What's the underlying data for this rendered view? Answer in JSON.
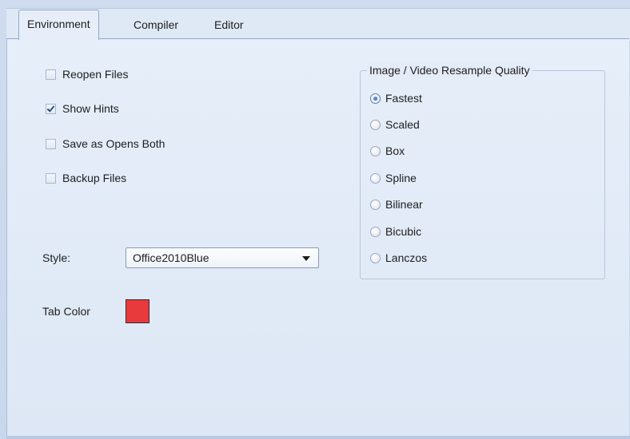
{
  "tabs": [
    {
      "label": "Environment",
      "active": true
    },
    {
      "label": "Compiler",
      "active": false
    },
    {
      "label": "Editor",
      "active": false
    }
  ],
  "options": [
    {
      "label": "Reopen Files",
      "checked": false
    },
    {
      "label": "Show Hints",
      "checked": true
    },
    {
      "label": "Save as Opens Both",
      "checked": false
    },
    {
      "label": "Backup Files",
      "checked": false
    }
  ],
  "style": {
    "label": "Style:",
    "selected": "Office2010Blue"
  },
  "tab_color": {
    "label": "Tab Color",
    "value": "#e8393d"
  },
  "resample": {
    "title": "Image / Video Resample Quality",
    "options": [
      {
        "label": "Fastest",
        "selected": true
      },
      {
        "label": "Scaled",
        "selected": false
      },
      {
        "label": "Box",
        "selected": false
      },
      {
        "label": "Spline",
        "selected": false
      },
      {
        "label": "Bilinear",
        "selected": false
      },
      {
        "label": "Bicubic",
        "selected": false
      },
      {
        "label": "Lanczos",
        "selected": false
      }
    ]
  },
  "colors": {
    "accent": "#8fa8cc",
    "panel": "#e6eef9"
  }
}
